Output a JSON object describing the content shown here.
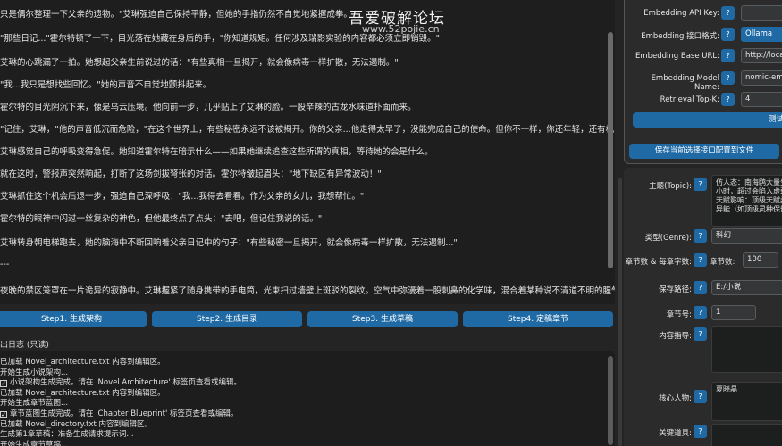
{
  "watermark": {
    "title": "吾爱破解论坛",
    "url": "www.52pojie.cn"
  },
  "editor": {
    "paragraphs": [
      "只是偶尔整理一下父亲的遗物。\"艾琳强迫自己保持平静，但她的手指仍然不自觉地紧握成拳。",
      "\"那些日记...\"霍尔特顿了一下，目光落在她藏在身后的手，\"你知道规矩。任何涉及瑞影实验的内容都必须立即销毁。\"",
      "艾琳的心跳漏了一拍。她想起父亲生前说过的话：\"有些真相一旦揭开，就会像病毒一样扩散，无法遏制。\"",
      "\"我...我只是想找些回忆。\"她的声音不自觉地颤抖起来。",
      "霍尔特的目光阴沉下来，像是乌云压境。他向前一步，几乎贴上了艾琳的脸。一股辛辣的古龙水味道扑面而来。",
      "\"记住，艾琳，\"他的声音低沉而危险，\"在这个世界上，有些秘密永远不该被揭开。你的父亲...他走得太早了，没能完成自己的使命。但你不一样，你还年轻，还有机会。\"",
      "艾琳感觉自己的呼吸变得急促。她知道霍尔特在暗示什么——如果她继续追查这些所谓的真相，等待她的会是什么。",
      "就在这时，警报声突然响起，打断了这场剑拔弩张的对话。霍尔特皱起眉头：\"地下缺区有异常波动！\"",
      "艾琳抓住这个机会后退一步，强迫自己深呼吸：\"我...我得去看看。作为父亲的女儿，我想帮忙。\"",
      "霍尔特的眼神中闪过一丝复杂的神色，但他最终点了点头：\"去吧，但记住我说的话。\"",
      "艾琳转身朝电梯跑去，她的脑海中不断回响着父亲日记中的句子：\"有些秘密一旦揭开，就会像病毒一样扩散，无法遏制...\"",
      "---",
      "夜晚的禁区笼罩在一片诡异的寂静中。艾琳握紧了随身携带的手电筒，光束扫过墙壁上斑驳的裂纹。空气中弥漫着一股刺鼻的化学味，混合着某种说不清道不明的腥气。"
    ]
  },
  "steps": {
    "step1": "Step1. 生成架构",
    "step2": "Step2. 生成目录",
    "step3": "Step3. 生成草稿",
    "step4": "Step4. 定稿章节"
  },
  "log": {
    "title": "出日志 (只读)",
    "lines": [
      {
        "text": "已加载 Novel_architecture.txt 内容到编辑区。",
        "check": false
      },
      {
        "text": "开始生成小说架构...",
        "check": false
      },
      {
        "text": "小说架构生成完成。请在 'Novel Architecture' 标签页查看或编辑。",
        "check": true
      },
      {
        "text": "已加载 Novel_architecture.txt 内容到编辑区。",
        "check": false
      },
      {
        "text": "开始生成章节蓝图...",
        "check": false
      },
      {
        "text": "章节蓝图生成完成。请在 'Chapter Blueprint' 标签页查看或编辑。",
        "check": true
      },
      {
        "text": "已加载 Novel_directory.txt 内容到编辑区。",
        "check": false
      },
      {
        "text": "生成第1章草稿：准备生成请求提示词...",
        "check": false
      },
      {
        "text": "开始生成章节草稿...",
        "check": false
      }
    ]
  },
  "embedding": {
    "api_key_label": "Embedding API Key:",
    "api_key_value": "",
    "interface_label": "Embedding 接口格式:",
    "interface_value": "Ollama",
    "base_url_label": "Embedding Base URL:",
    "base_url_value": "http://localh",
    "model_label": "Embedding Model Name:",
    "model_value": "nomic-emb",
    "topk_label": "Retrieval Top-K:",
    "topk_value": "4",
    "test_button": "测试",
    "save_button": "保存当前选择接口配置到文件",
    "help": "?"
  },
  "novel": {
    "topic_label": "主题(Topic):",
    "topic_value": "仿人态：南海鸥大量生\n小时，超过会陷入虚弱\n天赋影响：顶级天赋类\n异能（如顶级灵种保留",
    "genre_label": "类型(Genre):",
    "genre_value": "科幻",
    "chapters_label": "章节数 & 每章字数:",
    "chapters_inner_label": "章节数:",
    "chapters_value": "100",
    "save_path_label": "保存路径:",
    "save_path_value": "E:/小说",
    "chapter_no_label": "章节号:",
    "chapter_no_value": "1",
    "guidance_label": "内容指导:",
    "guidance_value": "",
    "characters_label": "核心人物:",
    "characters_value": "夏晓晶",
    "items_label": "关键道具:",
    "items_value": ""
  }
}
